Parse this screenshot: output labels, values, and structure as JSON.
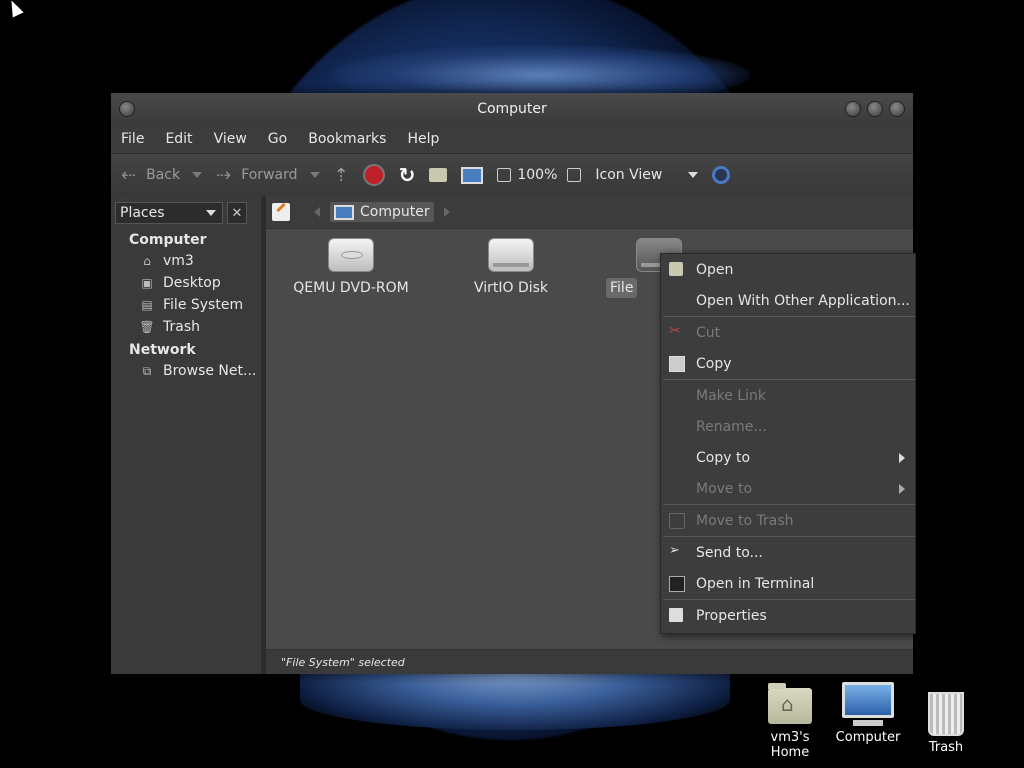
{
  "window": {
    "title": "Computer"
  },
  "menubar": [
    "File",
    "Edit",
    "View",
    "Go",
    "Bookmarks",
    "Help"
  ],
  "toolbar": {
    "back": "Back",
    "forward": "Forward",
    "zoom": "100%",
    "view_mode": "Icon View",
    "icons": [
      "back-icon",
      "forward-icon",
      "up-icon",
      "stop-icon",
      "reload-icon",
      "home-icon",
      "computer-icon",
      "zoom-out-icon",
      "zoom-in-icon",
      "search-icon"
    ]
  },
  "sidebar": {
    "selector": "Places",
    "sections": [
      {
        "title": "Computer",
        "items": [
          "vm3",
          "Desktop",
          "File System",
          "Trash"
        ]
      },
      {
        "title": "Network",
        "items": [
          "Browse Net..."
        ]
      }
    ]
  },
  "pathbar": {
    "crumb": "Computer"
  },
  "devices": [
    "QEMU DVD-ROM",
    "VirtIO Disk",
    "File"
  ],
  "status": "\"File System\" selected",
  "context_menu": {
    "items": [
      {
        "label": "Open",
        "enabled": true
      },
      {
        "label": "Open With Other Application...",
        "enabled": true
      },
      {
        "label": "Cut",
        "enabled": false
      },
      {
        "label": "Copy",
        "enabled": true
      },
      {
        "label": "Make Link",
        "enabled": false
      },
      {
        "label": "Rename...",
        "enabled": false
      },
      {
        "label": "Copy to",
        "enabled": true
      },
      {
        "label": "Move to",
        "enabled": false
      },
      {
        "label": "Move to Trash",
        "enabled": false
      },
      {
        "label": "Send to...",
        "enabled": true
      },
      {
        "label": "Open in Terminal",
        "enabled": true
      },
      {
        "label": "Properties",
        "enabled": true
      }
    ]
  },
  "desktop_icons": [
    "vm3's Home",
    "Computer",
    "Trash"
  ],
  "colors": {
    "accent_stop": "#c0202a",
    "reload": "#ffffff",
    "search": "#4a78c8"
  }
}
